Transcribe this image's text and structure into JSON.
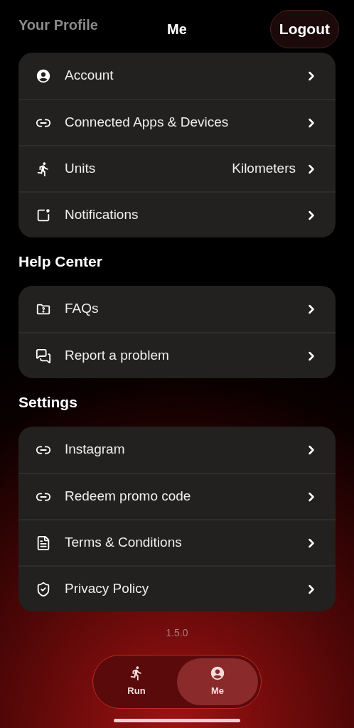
{
  "header": {
    "faded_title": "Your Profile",
    "title": "Me",
    "logout": "Logout"
  },
  "sections": [
    {
      "items": [
        {
          "label": "Account"
        },
        {
          "label": "Connected Apps & Devices"
        },
        {
          "label": "Units",
          "value": "Kilometers"
        },
        {
          "label": "Notifications"
        }
      ]
    },
    {
      "heading": "Help Center",
      "items": [
        {
          "label": "FAQs"
        },
        {
          "label": "Report a problem"
        }
      ]
    },
    {
      "heading": "Settings",
      "items": [
        {
          "label": "Instagram"
        },
        {
          "label": "Redeem promo code"
        },
        {
          "label": "Terms & Conditions"
        },
        {
          "label": "Privacy Policy"
        }
      ]
    }
  ],
  "version": "1.5.0",
  "tab_bar": [
    {
      "label": "Run",
      "selected": false
    },
    {
      "label": "Me",
      "selected": true
    }
  ]
}
